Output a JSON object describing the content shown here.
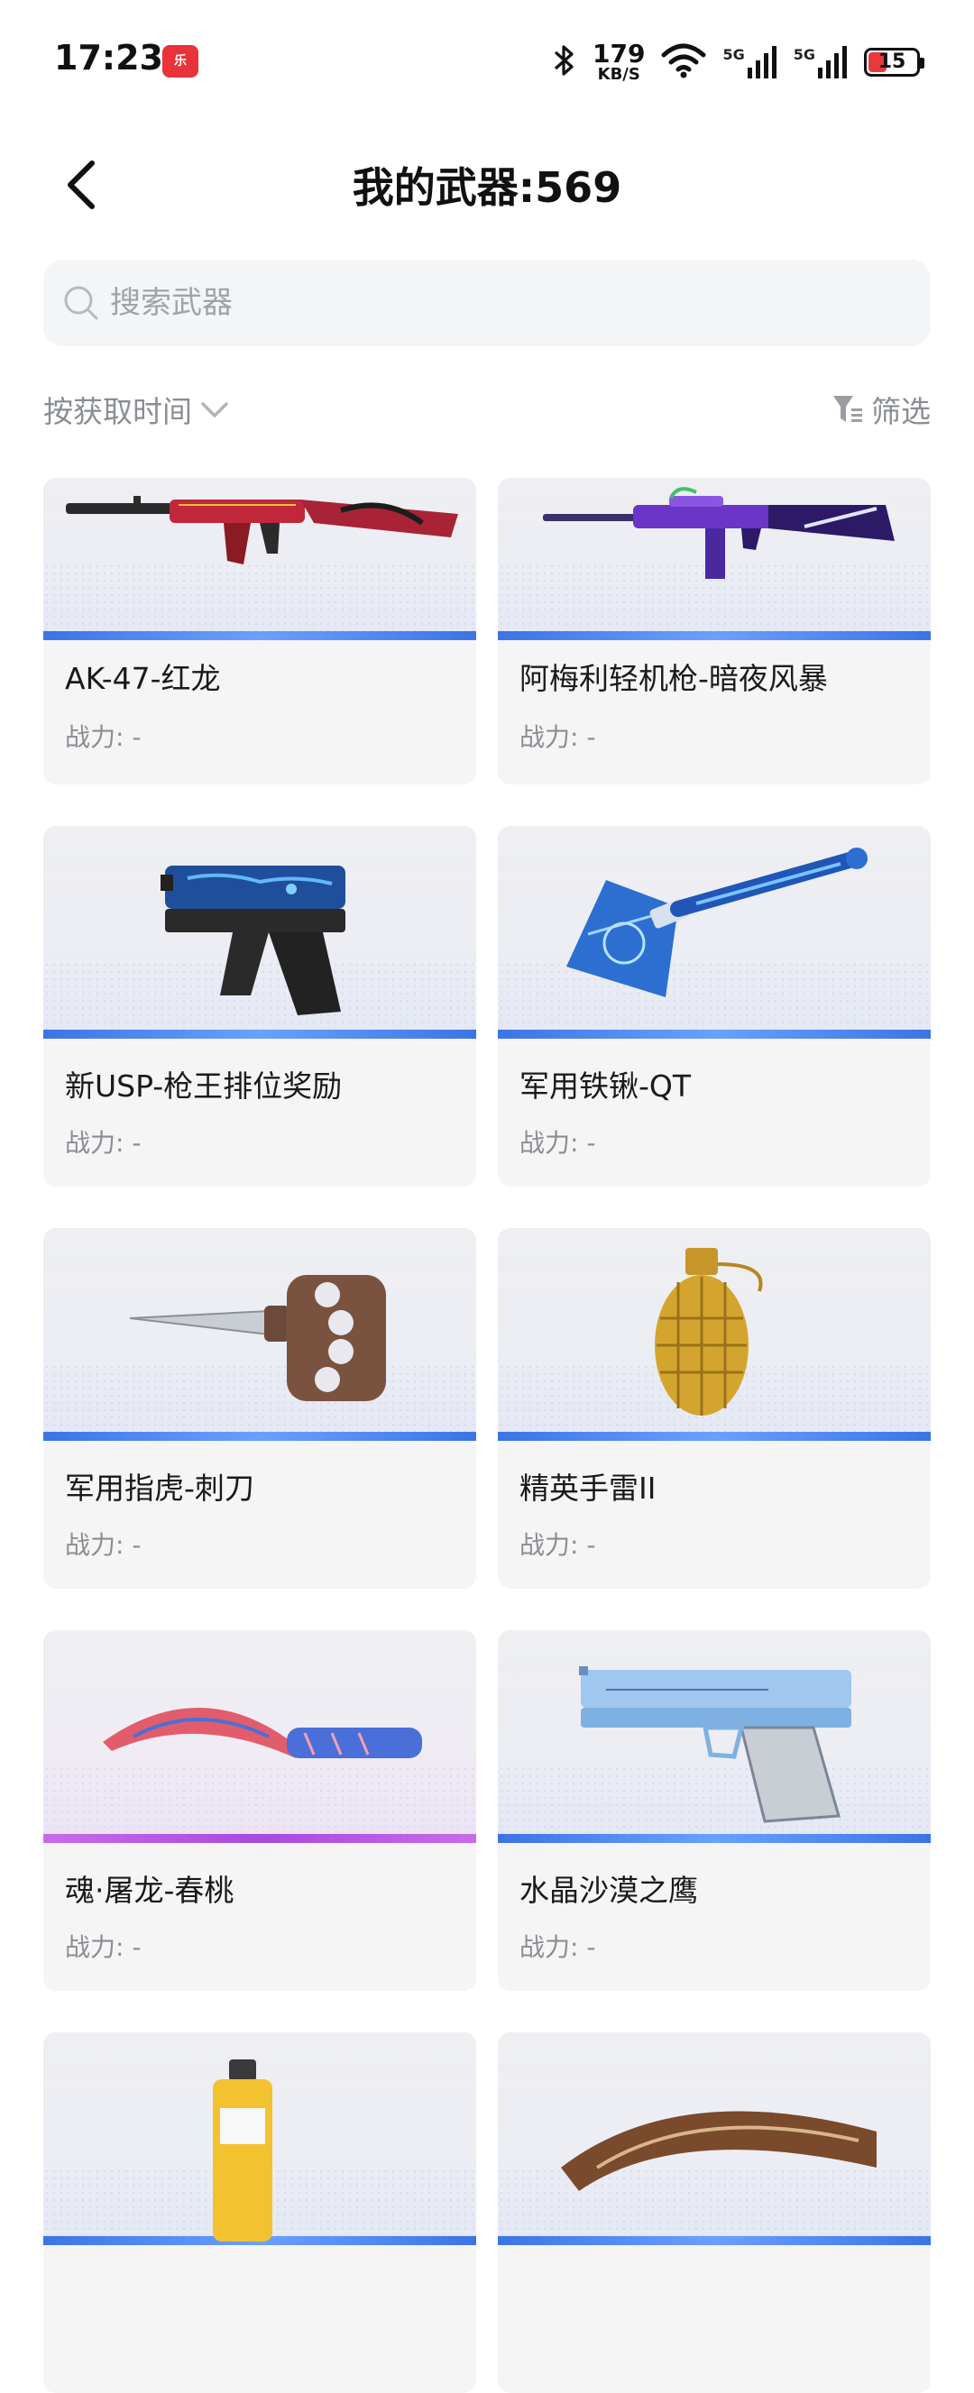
{
  "status_bar": {
    "time": "17:23",
    "app_badge": "乐",
    "net_speed_value": "179",
    "net_speed_unit": "KB/S",
    "signal1": "5G",
    "signal2": "5G",
    "battery": "15",
    "colors": {
      "battery_low": "#e83a3a"
    }
  },
  "header": {
    "title": "我的武器:569",
    "back_icon": "chevron-left-icon"
  },
  "search": {
    "placeholder": "搜索武器",
    "icon": "search-icon"
  },
  "sort_bar": {
    "sort_label": "按获取时间",
    "sort_icon": "chevron-down-icon",
    "filter_label": "筛选",
    "filter_icon": "filter-icon"
  },
  "weapons": [
    {
      "name": "AK-47-红龙",
      "power": "战力: -"
    },
    {
      "name": "阿梅利轻机枪-暗夜风暴",
      "power": "战力: -"
    },
    {
      "name": "新USP-枪王排位奖励",
      "power": "战力: -"
    },
    {
      "name": "军用铁锹-QT",
      "power": "战力: -"
    },
    {
      "name": "军用指虎-刺刀",
      "power": "战力: -"
    },
    {
      "name": "精英手雷II",
      "power": "战力: -"
    },
    {
      "name": "魂·屠龙-春桃",
      "power": "战力: -"
    },
    {
      "name": "水晶沙漠之鹰",
      "power": "战力: -"
    },
    {
      "name": "",
      "power": ""
    },
    {
      "name": "",
      "power": ""
    }
  ],
  "colors": {
    "accent_blue": "#3c74e6",
    "accent_purple": "#a64ae0",
    "muted_text": "#8a8d92"
  }
}
